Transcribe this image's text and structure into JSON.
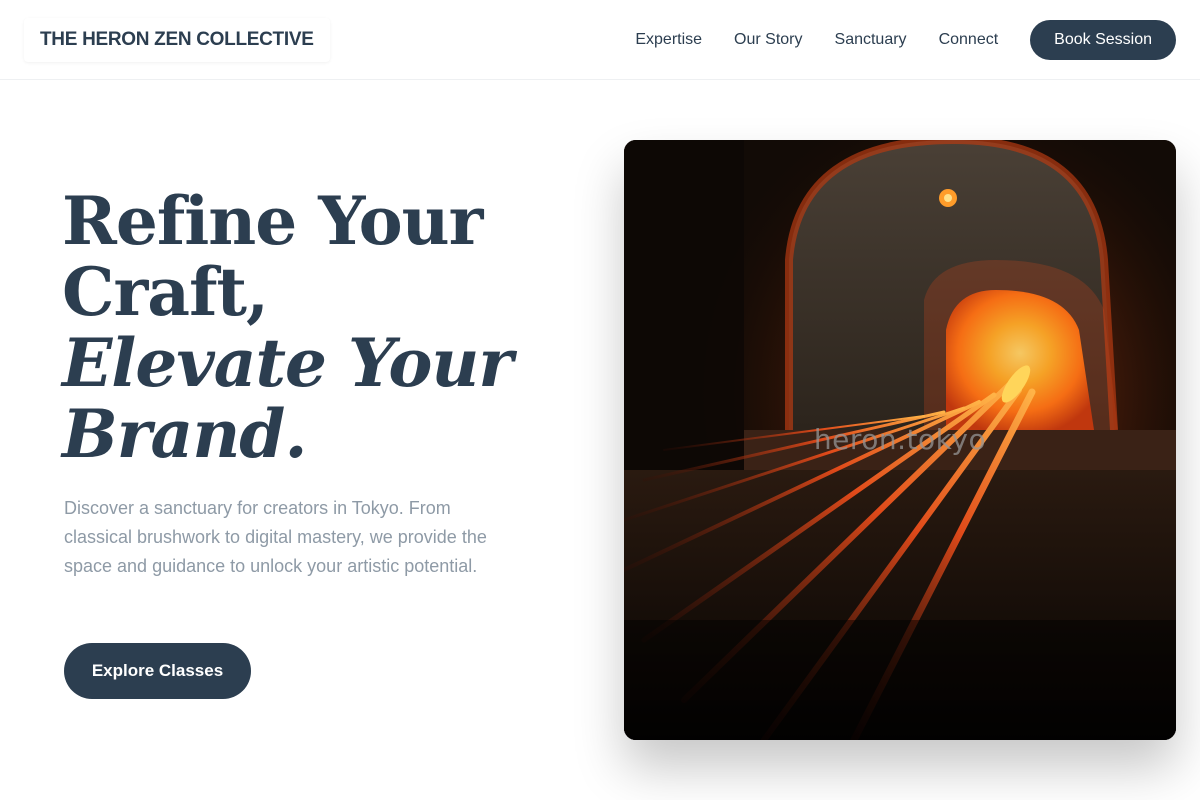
{
  "header": {
    "logo": "THE HERON ZEN COLLECTIVE",
    "nav": [
      {
        "label": "Expertise"
      },
      {
        "label": "Our Story"
      },
      {
        "label": "Sanctuary"
      },
      {
        "label": "Connect"
      }
    ],
    "cta_label": "Book Session"
  },
  "hero": {
    "title_lines": [
      "Refine Your",
      "Craft,",
      "Elevate Your",
      "Brand."
    ],
    "description": "Discover a sanctuary for creators in Tokyo. From classical brushwork to digital mastery, we provide the space and guidance to unlock your artistic potential.",
    "button_label": "Explore Classes",
    "image": {
      "subject": "glowing glass furnace with metal rods",
      "watermark": "heron.tokyo"
    }
  },
  "colors": {
    "primary": "#2c3e50",
    "muted_text": "#8e9aa6",
    "background": "#ffffff"
  }
}
